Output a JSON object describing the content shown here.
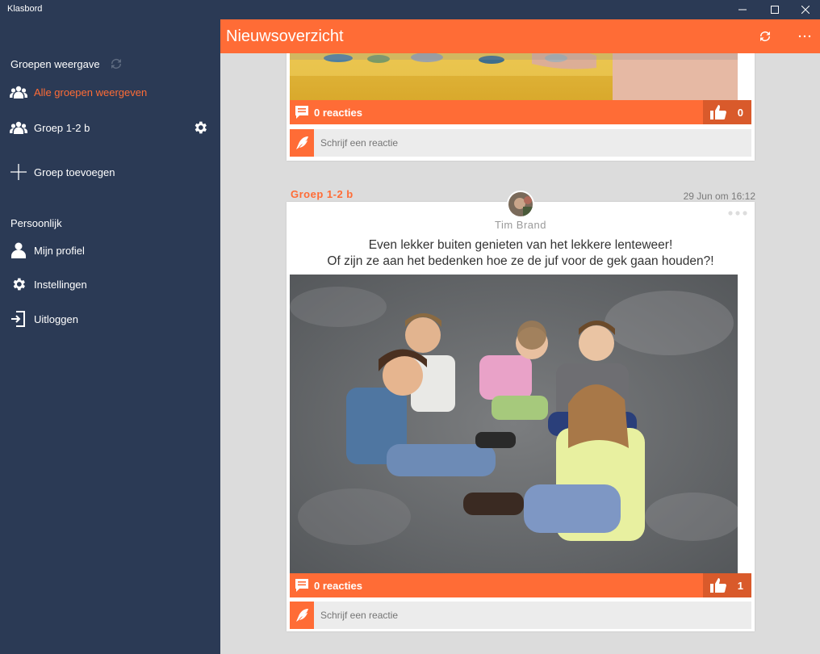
{
  "window": {
    "title": "Klasbord"
  },
  "sidebar": {
    "groups_heading": "Groepen weergave",
    "items": [
      {
        "label": "Alle groepen weergeven",
        "icon": "groups-icon"
      },
      {
        "label": "Groep 1-2 b",
        "icon": "groups-icon"
      },
      {
        "label": "Groep toevoegen",
        "icon": "plus-icon"
      }
    ],
    "personal_heading": "Persoonlijk",
    "personal_items": [
      {
        "label": "Mijn profiel",
        "icon": "user-icon"
      },
      {
        "label": "Instellingen",
        "icon": "gear-icon"
      },
      {
        "label": "Uitloggen",
        "icon": "logout-icon"
      }
    ]
  },
  "header": {
    "title": "Nieuwsoverzicht"
  },
  "posts": [
    {
      "reactions_label": "0 reacties",
      "like_count": "0",
      "comment_placeholder": "Schrijf een reactie"
    },
    {
      "group": "Groep 1-2 b",
      "date": "29 Jun om 16:12",
      "author": "Tim Brand",
      "text_line1": "Even lekker buiten genieten van het lekkere lenteweer!",
      "text_line2": "Of zijn ze aan het bedenken hoe ze de juf voor de gek gaan houden?!",
      "reactions_label": "0 reacties",
      "like_count": "1",
      "comment_placeholder": "Schrijf een reactie"
    }
  ],
  "colors": {
    "accent": "#ff6c36",
    "accent_dark": "#d95a2b",
    "sidebar": "#2b3a55",
    "content_bg": "#dcdcdc"
  }
}
